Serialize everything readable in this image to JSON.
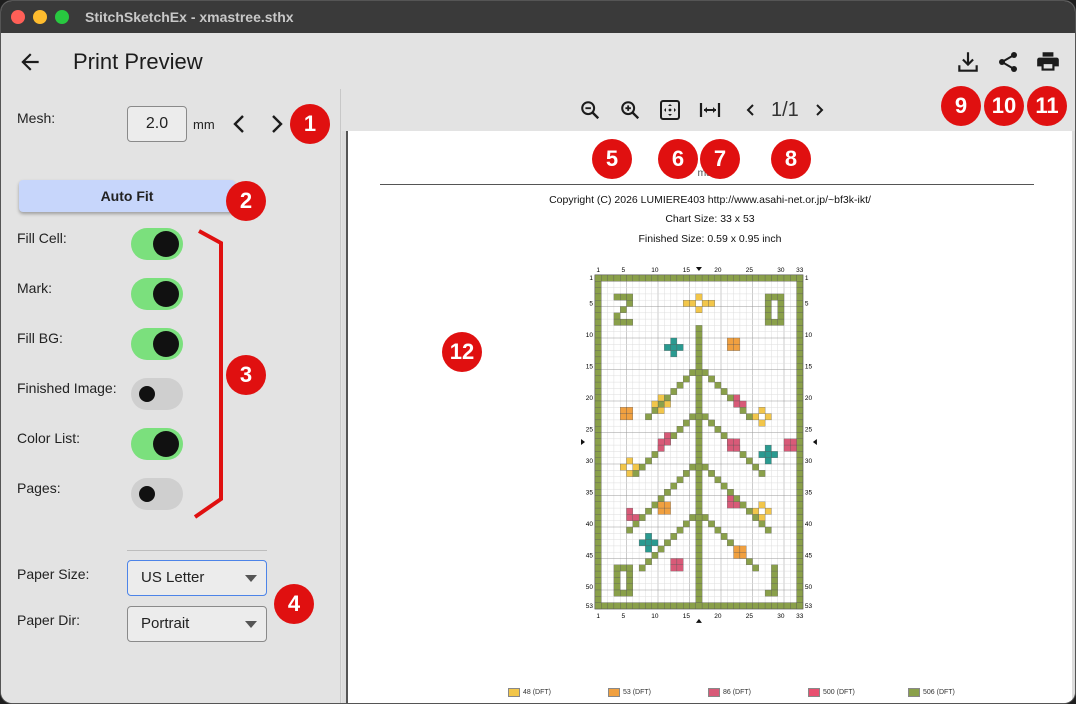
{
  "window": {
    "title": "StitchSketchEx - xmastree.sthx"
  },
  "appbar": {
    "title": "Print Preview",
    "back_icon": "arrow-left-icon",
    "actions": [
      "download-icon",
      "share-icon",
      "print-icon"
    ]
  },
  "settings": {
    "mesh_label": "Mesh:",
    "mesh_value": "2.0",
    "mesh_unit": "mm",
    "auto_fit_label": "Auto Fit",
    "toggles": [
      {
        "label": "Fill Cell:",
        "on": true
      },
      {
        "label": "Mark:",
        "on": true
      },
      {
        "label": "Fill BG:",
        "on": true
      },
      {
        "label": "Finished Image:",
        "on": false
      },
      {
        "label": "Color List:",
        "on": true
      },
      {
        "label": "Pages:",
        "on": false
      }
    ],
    "paper_size_label": "Paper Size:",
    "paper_size_value": "US Letter",
    "paper_dir_label": "Paper Dir:",
    "paper_dir_value": "Portrait"
  },
  "preview_toolbar": {
    "zoom_out_icon": "zoom-out-icon",
    "zoom_in_icon": "zoom-in-icon",
    "fit_icon": "fit-page-icon",
    "fit_width_icon": "fit-width-icon",
    "page_indicator": "1/1"
  },
  "paper": {
    "title_fragment": "masz",
    "copyright": "Copyright (C) 2026 LUMIERE403 http://www.asahi-net.or.jp/~bf3k-ikt/",
    "chart_size": "Chart Size: 33 x 53",
    "finished_size": "Finished Size: 0.59 x 0.95 inch",
    "x_ticks": [
      "1",
      "5",
      "10",
      "15",
      "20",
      "25",
      "30",
      "33"
    ],
    "y_ticks": [
      "1",
      "5",
      "10",
      "15",
      "20",
      "25",
      "30",
      "35",
      "40",
      "45",
      "50",
      "53"
    ],
    "legend": [
      {
        "label": "48 (DFT)",
        "color": "#f2c64a"
      },
      {
        "label": "53 (DFT)",
        "color": "#f0a040"
      },
      {
        "label": "86 (DFT)",
        "color": "#d85a78"
      },
      {
        "label": "500 (DFT)",
        "color": "#e85070"
      },
      {
        "label": "506 (DFT)",
        "color": "#8aa04a"
      }
    ]
  },
  "annotations": [
    "1",
    "2",
    "3",
    "4",
    "5",
    "6",
    "7",
    "8",
    "9",
    "10",
    "11",
    "12"
  ]
}
